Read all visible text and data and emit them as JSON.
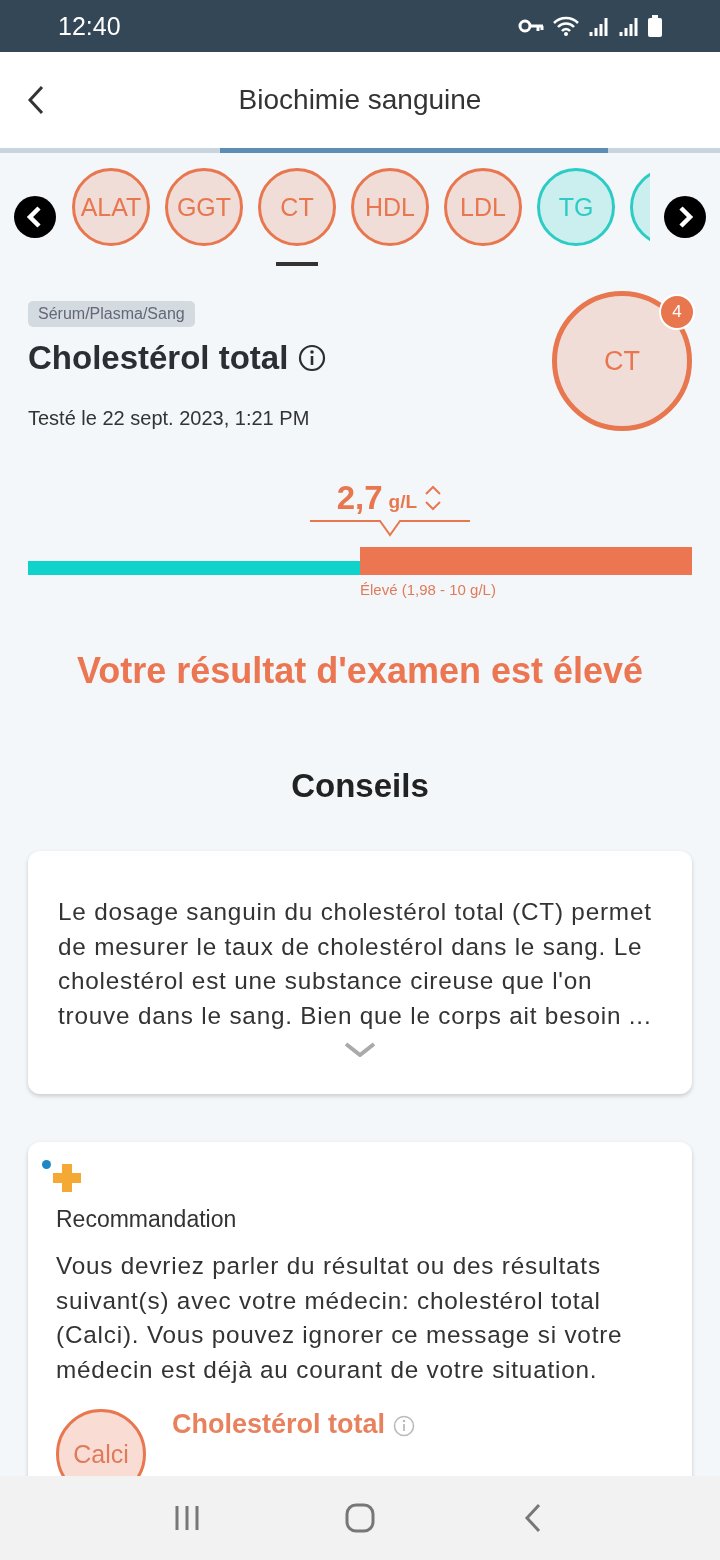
{
  "status_bar": {
    "time": "12:40"
  },
  "header": {
    "title": "Biochimie sanguine"
  },
  "chips": [
    {
      "label": "ALAT",
      "color": "#e8774f",
      "selected": false
    },
    {
      "label": "GGT",
      "color": "#e8774f",
      "selected": false
    },
    {
      "label": "CT",
      "color": "#e8774f",
      "selected": true
    },
    {
      "label": "HDL",
      "color": "#e8774f",
      "selected": false
    },
    {
      "label": "LDL",
      "color": "#e8774f",
      "selected": false
    },
    {
      "label": "TG",
      "color": "#2cccc4",
      "selected": false
    },
    {
      "color": "#2cccc4",
      "selected": false
    }
  ],
  "test": {
    "specimen": "Sérum/Plasma/Sang",
    "name": "Cholestérol total",
    "date": "Testé le 22 sept. 2023, 1:21 PM",
    "badge_label": "CT",
    "badge_count": "4"
  },
  "result": {
    "value": "2,7",
    "unit": "g/L",
    "range_bar": {
      "level": 0.5
    },
    "range_label": "Élevé (1,98 - 10 g/L)",
    "message": "Votre résultat d'examen est élevé"
  },
  "advice": {
    "title": "Conseils",
    "text": "Le dosage sanguin du cholestérol total (CT) permet de mesurer le taux de cholestérol dans le sang. Le cholestérol est une substance cireuse que l'on trouve dans le sang. Bien que le corps ait besoin ...",
    "expanded": false
  },
  "recommendation": {
    "title": "Recommandation",
    "text": "Vous devriez parler du résultat ou des résultats suivant(s) avec votre médecin: cholestérol total (Calci). Vous pouvez ignorer ce message si votre médecin est déjà au courant de votre situation.",
    "item_badge": "Calci",
    "item_name": "Cholestérol total"
  }
}
